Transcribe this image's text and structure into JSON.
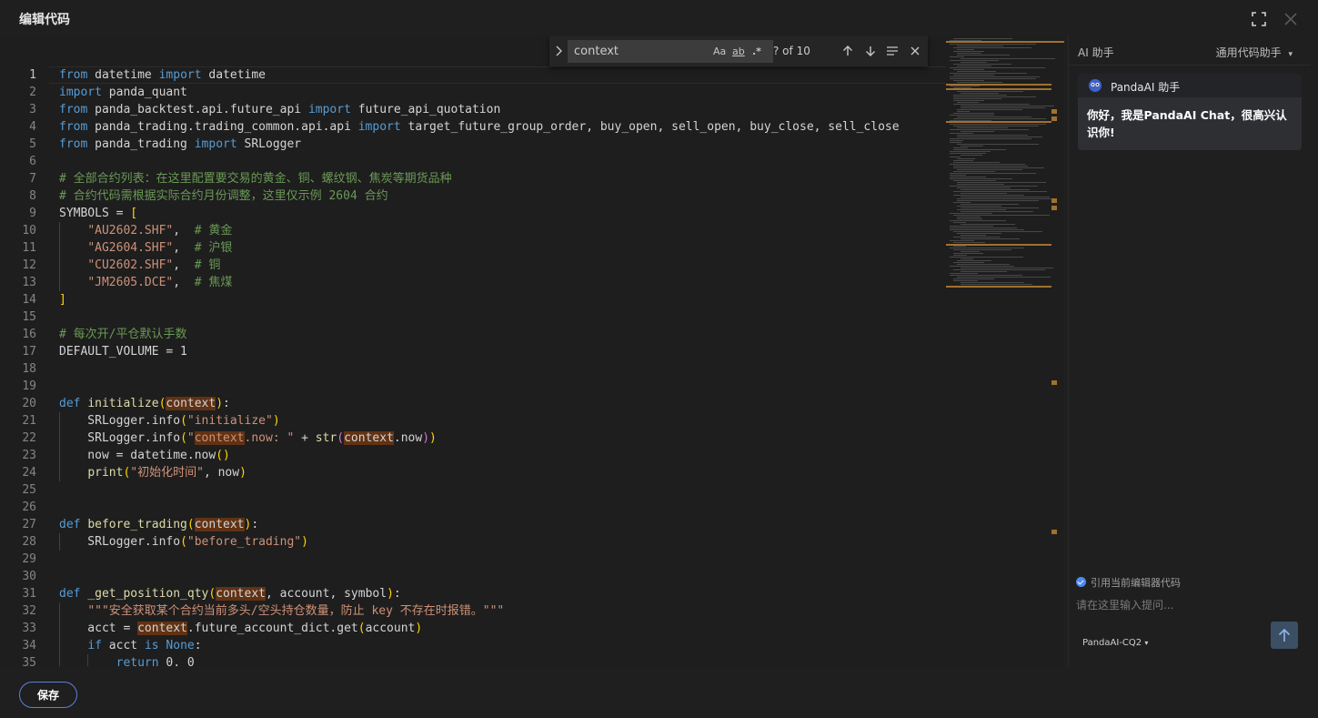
{
  "dialog": {
    "title": "编辑代码"
  },
  "find": {
    "query": "context",
    "count": "? of 10",
    "opt_case": "Aa",
    "opt_word": "ab",
    "opt_regex": ".*"
  },
  "editor": {
    "lines": [
      {
        "n": "1",
        "html": "<span class=\"kw\">from</span> datetime <span class=\"kw\">import</span> datetime"
      },
      {
        "n": "2",
        "html": "<span class=\"kw\">import</span> panda_quant"
      },
      {
        "n": "3",
        "html": "<span class=\"kw\">from</span> panda_backtest.api.future_api <span class=\"kw\">import</span> future_api_quotation"
      },
      {
        "n": "4",
        "html": "<span class=\"kw\">from</span> panda_trading.trading_common.api.api <span class=\"kw\">import</span> target_future_group_order, buy_open, sell_open, buy_close, sell_close"
      },
      {
        "n": "5",
        "html": "<span class=\"kw\">from</span> panda_trading <span class=\"kw\">import</span> SRLogger"
      },
      {
        "n": "6",
        "html": ""
      },
      {
        "n": "7",
        "html": "<span class=\"cm\"># 全部合约列表：在这里配置要交易的黄金、铜、螺纹钢、焦炭等期货品种</span>"
      },
      {
        "n": "8",
        "html": "<span class=\"cm\"># 合约代码需根据实际合约月份调整，这里仅示例 2604 合约</span>"
      },
      {
        "n": "9",
        "html": "SYMBOLS = <span class=\"bk\">[</span>"
      },
      {
        "n": "10",
        "html": "    <span class=\"st\">\"AU2602.SHF\"</span>,  <span class=\"cm\"># 黄金</span>"
      },
      {
        "n": "11",
        "html": "    <span class=\"st\">\"AG2604.SHF\"</span>,  <span class=\"cm\"># 沪银</span>"
      },
      {
        "n": "12",
        "html": "    <span class=\"st\">\"CU2602.SHF\"</span>,  <span class=\"cm\"># 铜</span>"
      },
      {
        "n": "13",
        "html": "    <span class=\"st\">\"JM2605.DCE\"</span>,  <span class=\"cm\"># 焦煤</span>"
      },
      {
        "n": "14",
        "html": "<span class=\"bk\">]</span>"
      },
      {
        "n": "15",
        "html": ""
      },
      {
        "n": "16",
        "html": "<span class=\"cm\"># 每次开/平仓默认手数</span>"
      },
      {
        "n": "17",
        "html": "DEFAULT_VOLUME = 1"
      },
      {
        "n": "18",
        "html": ""
      },
      {
        "n": "19",
        "html": ""
      },
      {
        "n": "20",
        "html": "<span class=\"kw\">def</span> <span class=\"fn\">initialize</span><span class=\"bk\">(</span><span class=\"hl\">context</span><span class=\"bk\">)</span>:"
      },
      {
        "n": "21",
        "html": "    SRLogger.info<span class=\"bk\">(</span><span class=\"st\">\"initialize\"</span><span class=\"bk\">)</span>"
      },
      {
        "n": "22",
        "html": "    SRLogger.info<span class=\"bk\">(</span><span class=\"st\">\"<span class=\"hl\">context</span>.now: \"</span> + <span class=\"fn\">str</span><span class=\"bp\">(</span><span class=\"hl\">context</span>.now<span class=\"bp\">)</span><span class=\"bk\">)</span>"
      },
      {
        "n": "23",
        "html": "    now = datetime.now<span class=\"bk\">()</span>"
      },
      {
        "n": "24",
        "html": "    <span class=\"fn\">print</span><span class=\"bk\">(</span><span class=\"st\">\"初始化时间\"</span>, now<span class=\"bk\">)</span>"
      },
      {
        "n": "25",
        "html": ""
      },
      {
        "n": "26",
        "html": ""
      },
      {
        "n": "27",
        "html": "<span class=\"kw\">def</span> <span class=\"fn\">before_trading</span><span class=\"bk\">(</span><span class=\"hl\">context</span><span class=\"bk\">)</span>:"
      },
      {
        "n": "28",
        "html": "    SRLogger.info<span class=\"bk\">(</span><span class=\"st\">\"before_trading\"</span><span class=\"bk\">)</span>"
      },
      {
        "n": "29",
        "html": ""
      },
      {
        "n": "30",
        "html": ""
      },
      {
        "n": "31",
        "html": "<span class=\"kw\">def</span> <span class=\"fn\">_get_position_qty</span><span class=\"bk\">(</span><span class=\"hl\">context</span>, account, symbol<span class=\"bk\">)</span>:"
      },
      {
        "n": "32",
        "html": "    <span class=\"st\">\"\"\"安全获取某个合约当前多头/空头持仓数量，防止 key 不存在时报错。\"\"\"</span>"
      },
      {
        "n": "33",
        "html": "    acct = <span class=\"hl\">context</span>.future_account_dict.get<span class=\"bk\">(</span>account<span class=\"bk\">)</span>"
      },
      {
        "n": "34",
        "html": "    <span class=\"kw\">if</span> acct <span class=\"kw\">is</span> <span class=\"kw\">None</span>:"
      },
      {
        "n": "35",
        "html": "        <span class=\"kw\">return</span> 0, 0"
      }
    ]
  },
  "panel": {
    "title": "AI 助手",
    "mode": "通用代码助手",
    "bot_name": "PandaAI 助手",
    "greeting": "你好，我是PandaAI Chat，很高兴认识你!",
    "ref_label": "引用当前编辑器代码",
    "prompt_placeholder": "请在这里输入提问...",
    "model": "PandaAI-CQ2"
  },
  "footer": {
    "save_label": "保存"
  }
}
